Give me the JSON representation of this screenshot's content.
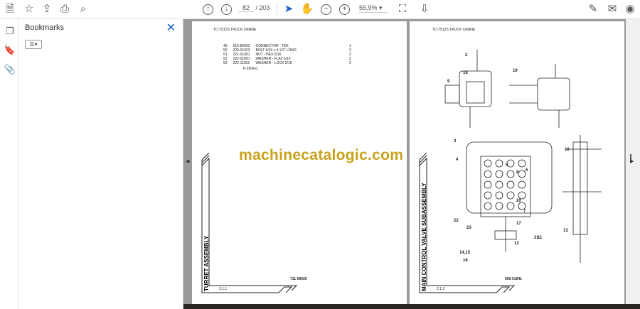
{
  "toolbar": {
    "icons": [
      "save-icon",
      "bookmark-star-icon",
      "upload-icon",
      "print-icon",
      "search-icon",
      "prev-page-icon",
      "next-page-icon",
      "select-cursor-icon",
      "hand-icon",
      "zoom-out-icon",
      "zoom-in-icon",
      "fit-page-icon",
      "scroll-mode-icon",
      "sign-icon",
      "email-icon",
      "account-icon"
    ],
    "page_current": "82",
    "page_total": "/ 203",
    "zoom": "55,9%",
    "accent": "#1a5fc7"
  },
  "bookmarks": {
    "title": "Bookmarks",
    "close": "✕"
  },
  "left_page": {
    "header": "TC-7512S TRUCK CRANE",
    "parts": [
      [
        "49",
        "516-82003",
        "CONNECTOR - TEE",
        "1"
      ],
      [
        "50",
        "220-01023",
        "BOLT 5/16 x 4 1/2\" LONG",
        "2"
      ],
      [
        "51",
        "221-01001",
        "NUT - HEX 5/16",
        "2"
      ],
      [
        "52",
        "222-01001",
        "WASHER - FLAT 5/16",
        "2"
      ],
      [
        "53",
        "222-11002",
        "WASHER - LOCK 5/16",
        "2"
      ]
    ],
    "ref": "F-2504.0",
    "title": "TURRET ASSEMBLY",
    "section": "2.1.1",
    "drawing_no": "711-00020"
  },
  "right_page": {
    "header": "TC-7512S TRUCK CRANE",
    "title": "MAIN CONTROL VALVE SUBASSEMBLY",
    "section": "2.1.2",
    "drawing_no": "500-01641",
    "callouts": [
      "2",
      "3",
      "4",
      "5",
      "6",
      "7",
      "8",
      "9",
      "10",
      "11",
      "12",
      "13",
      "14,15",
      "16",
      "17",
      "18",
      "19",
      "20",
      "21",
      "22",
      "23"
    ]
  },
  "watermark": "machinecatalogic.com"
}
